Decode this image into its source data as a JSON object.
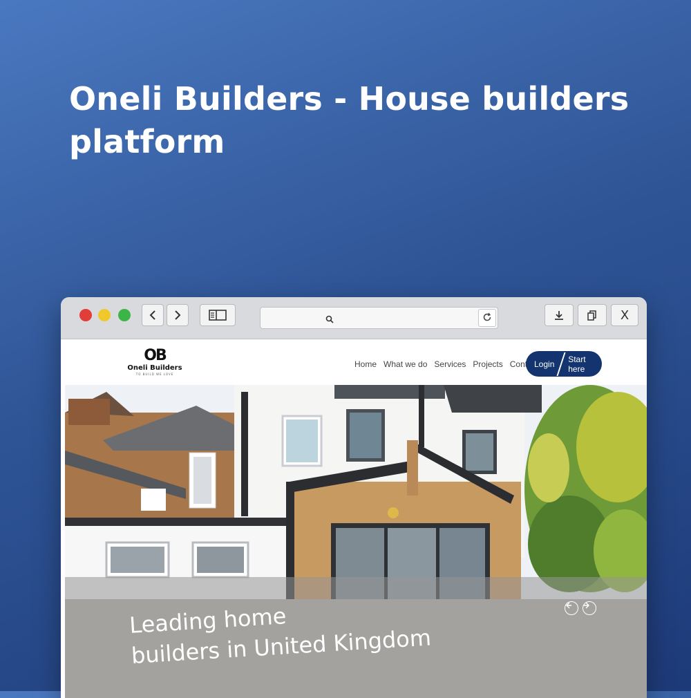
{
  "headline": "Oneli Builders - House builders platform",
  "browser": {
    "icons": {
      "back": "chevron-left-icon",
      "forward": "chevron-right-icon",
      "sidebar": "sidebar-icon",
      "search": "search-icon",
      "reload": "reload-icon",
      "download": "download-icon",
      "copy": "copy-icon",
      "close": "close-icon"
    },
    "close_label": "X"
  },
  "site": {
    "logo": {
      "mark": "OB",
      "name": "Oneli Builders",
      "tagline": "TO BUILD WE LOVE"
    },
    "nav": [
      "Home",
      "What we do",
      "Services",
      "Projects",
      "Contact"
    ],
    "login_label": "Login",
    "start_label": "Start here",
    "brand_color": "#14346f",
    "hero": {
      "line1": "Leading home",
      "line2": "builders in United Kingdom",
      "prev_icon": "arrow-left-icon",
      "next_icon": "arrow-right-icon"
    }
  }
}
